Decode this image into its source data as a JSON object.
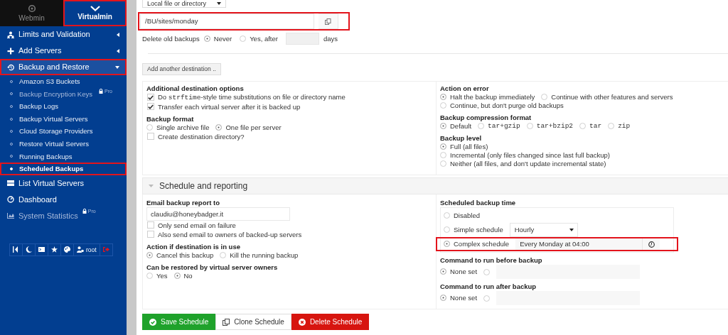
{
  "sidebar": {
    "tabs": [
      {
        "label": "Webmin",
        "selected": false,
        "highlighted": false
      },
      {
        "label": "Virtualmin",
        "selected": true,
        "highlighted": true
      }
    ],
    "menu": [
      {
        "label": "Limits and Validation",
        "expanded": false,
        "highlighted": false,
        "disabled": false
      },
      {
        "label": "Add Servers",
        "expanded": false,
        "highlighted": false,
        "disabled": false
      },
      {
        "label": "Backup and Restore",
        "expanded": true,
        "highlighted": true,
        "disabled": false,
        "children": [
          {
            "label": "Amazon S3 Buckets",
            "selected": false,
            "disabled": false,
            "highlighted": false
          },
          {
            "label": "Backup Encryption Keys",
            "selected": false,
            "disabled": true,
            "highlighted": false,
            "badge": "Pro"
          },
          {
            "label": "Backup Logs",
            "selected": false,
            "disabled": false,
            "highlighted": false
          },
          {
            "label": "Backup Virtual Servers",
            "selected": false,
            "disabled": false,
            "highlighted": false
          },
          {
            "label": "Cloud Storage Providers",
            "selected": false,
            "disabled": false,
            "highlighted": false
          },
          {
            "label": "Restore Virtual Servers",
            "selected": false,
            "disabled": false,
            "highlighted": false
          },
          {
            "label": "Running Backups",
            "selected": false,
            "disabled": false,
            "highlighted": false
          },
          {
            "label": "Scheduled Backups",
            "selected": true,
            "disabled": false,
            "highlighted": true
          }
        ]
      },
      {
        "label": "List Virtual Servers",
        "highlighted": false,
        "disabled": false
      },
      {
        "label": "Dashboard",
        "highlighted": false,
        "disabled": false
      },
      {
        "label": "System Statistics",
        "highlighted": false,
        "disabled": true,
        "badge": "Pro"
      }
    ],
    "toolbar": {
      "user": "root"
    }
  },
  "destination": {
    "rows": [
      {
        "highlighted": false,
        "items": [
          {
            "kind": "select",
            "value": "Local file or directory"
          }
        ]
      },
      {
        "highlighted": true,
        "items": [
          {
            "kind": "path",
            "value": "/BU/sites/monday"
          }
        ]
      },
      {
        "highlighted": false,
        "items": [
          {
            "kind": "label",
            "text": "Delete old backups"
          },
          {
            "kind": "radio",
            "label": "Never",
            "selected": true
          },
          {
            "kind": "radio",
            "label": "Yes, after",
            "selected": false
          },
          {
            "kind": "text"
          },
          {
            "kind": "label",
            "text": "days"
          }
        ]
      }
    ]
  },
  "add_destination_button": "Add another destination ..",
  "options": {
    "left": [
      {
        "title": "Additional destination options",
        "rows": [
          {
            "items": [
              {
                "kind": "checkbox",
                "checked": true,
                "label_parts": [
                  {
                    "text": "Do ",
                    "mono": false
                  },
                  {
                    "text": "strftime",
                    "mono": true
                  },
                  {
                    "text": "-style time substitutions on file or directory name",
                    "mono": false
                  }
                ]
              }
            ]
          },
          {
            "items": [
              {
                "kind": "checkbox",
                "checked": true,
                "label": "Transfer each virtual server after it is backed up"
              }
            ]
          }
        ]
      },
      {
        "title": "Backup format",
        "rows": [
          {
            "items": [
              {
                "kind": "radio",
                "label": "Single archive file",
                "selected": false
              },
              {
                "kind": "radio",
                "label": "One file per server",
                "selected": true
              }
            ]
          },
          {
            "items": [
              {
                "kind": "checkbox",
                "checked": false,
                "label": "Create destination directory?"
              }
            ]
          }
        ]
      }
    ],
    "right": [
      {
        "title": "Action on error",
        "rows": [
          {
            "items": [
              {
                "kind": "radio",
                "label": "Halt the backup immediately",
                "selected": true
              },
              {
                "kind": "radio",
                "label": "Continue with other features and servers",
                "selected": false
              }
            ]
          },
          {
            "items": [
              {
                "kind": "radio",
                "label": "Continue, but don't purge old backups",
                "selected": false
              }
            ]
          }
        ]
      },
      {
        "title": "Backup compression format",
        "rows": [
          {
            "items": [
              {
                "kind": "radio",
                "label": "Default",
                "selected": true,
                "mono": false
              },
              {
                "kind": "radio",
                "label": "tar+gzip",
                "selected": false,
                "mono": true
              },
              {
                "kind": "radio",
                "label": "tar+bzip2",
                "selected": false,
                "mono": true
              },
              {
                "kind": "radio",
                "label": "tar",
                "selected": false,
                "mono": true
              },
              {
                "kind": "radio",
                "label": "zip",
                "selected": false,
                "mono": true
              }
            ]
          }
        ]
      },
      {
        "title": "Backup level",
        "rows": [
          {
            "items": [
              {
                "kind": "radio",
                "label": "Full (all files)",
                "selected": true
              }
            ]
          },
          {
            "items": [
              {
                "kind": "radio",
                "label": "Incremental (only files changed since last full backup)",
                "selected": false
              }
            ]
          },
          {
            "items": [
              {
                "kind": "radio",
                "label": "Neither (all files, and don't update incremental state)",
                "selected": false
              }
            ]
          }
        ]
      }
    ]
  },
  "schedule": {
    "title": "Schedule and reporting",
    "expanded": true,
    "left": [
      {
        "title": "Email backup report to",
        "rows": [
          {
            "items": [
              {
                "kind": "text",
                "value": "claudiu@honeybadger.it"
              }
            ]
          },
          {
            "items": [
              {
                "kind": "checkbox",
                "checked": false,
                "label": "Only send email on failure"
              }
            ]
          },
          {
            "items": [
              {
                "kind": "checkbox",
                "checked": false,
                "label": "Also send email to owners of backed-up servers"
              }
            ]
          }
        ]
      },
      {
        "title": "Action if destination is in use",
        "rows": [
          {
            "items": [
              {
                "kind": "radio",
                "label": "Cancel this backup",
                "selected": true
              },
              {
                "kind": "radio",
                "label": "Kill the running backup",
                "selected": false
              }
            ]
          }
        ]
      },
      {
        "title": "Can be restored by virtual server owners",
        "rows": [
          {
            "items": [
              {
                "kind": "radio",
                "label": "Yes",
                "selected": false
              },
              {
                "kind": "radio",
                "label": "No",
                "selected": true
              }
            ]
          }
        ]
      }
    ],
    "right": [
      {
        "title": "Scheduled backup time",
        "boxed": true,
        "rows": [
          {
            "highlighted": false,
            "items": [
              {
                "kind": "radio",
                "label": "Disabled",
                "selected": false
              }
            ]
          },
          {
            "highlighted": false,
            "items": [
              {
                "kind": "radio",
                "label": "Simple schedule",
                "selected": false
              },
              {
                "kind": "select",
                "value": "Hourly"
              }
            ]
          },
          {
            "highlighted": true,
            "items": [
              {
                "kind": "radio",
                "label": "Complex schedule",
                "selected": true
              },
              {
                "kind": "schedule",
                "value": "Every Monday at 04:00"
              }
            ]
          }
        ]
      },
      {
        "title": "Command to run before backup",
        "rows": [
          {
            "items": [
              {
                "kind": "radio",
                "label": "None set",
                "selected": true
              },
              {
                "kind": "radio",
                "selected": false
              },
              {
                "kind": "text"
              }
            ]
          }
        ]
      },
      {
        "title": "Command to run after backup",
        "rows": [
          {
            "items": [
              {
                "kind": "radio",
                "label": "None set",
                "selected": true
              },
              {
                "kind": "radio",
                "selected": false
              },
              {
                "kind": "text"
              }
            ]
          }
        ]
      }
    ]
  },
  "buttons": [
    {
      "label": "Save Schedule",
      "kind": "save"
    },
    {
      "label": "Clone Schedule",
      "kind": "clone"
    },
    {
      "label": "Delete Schedule",
      "kind": "delete"
    }
  ]
}
